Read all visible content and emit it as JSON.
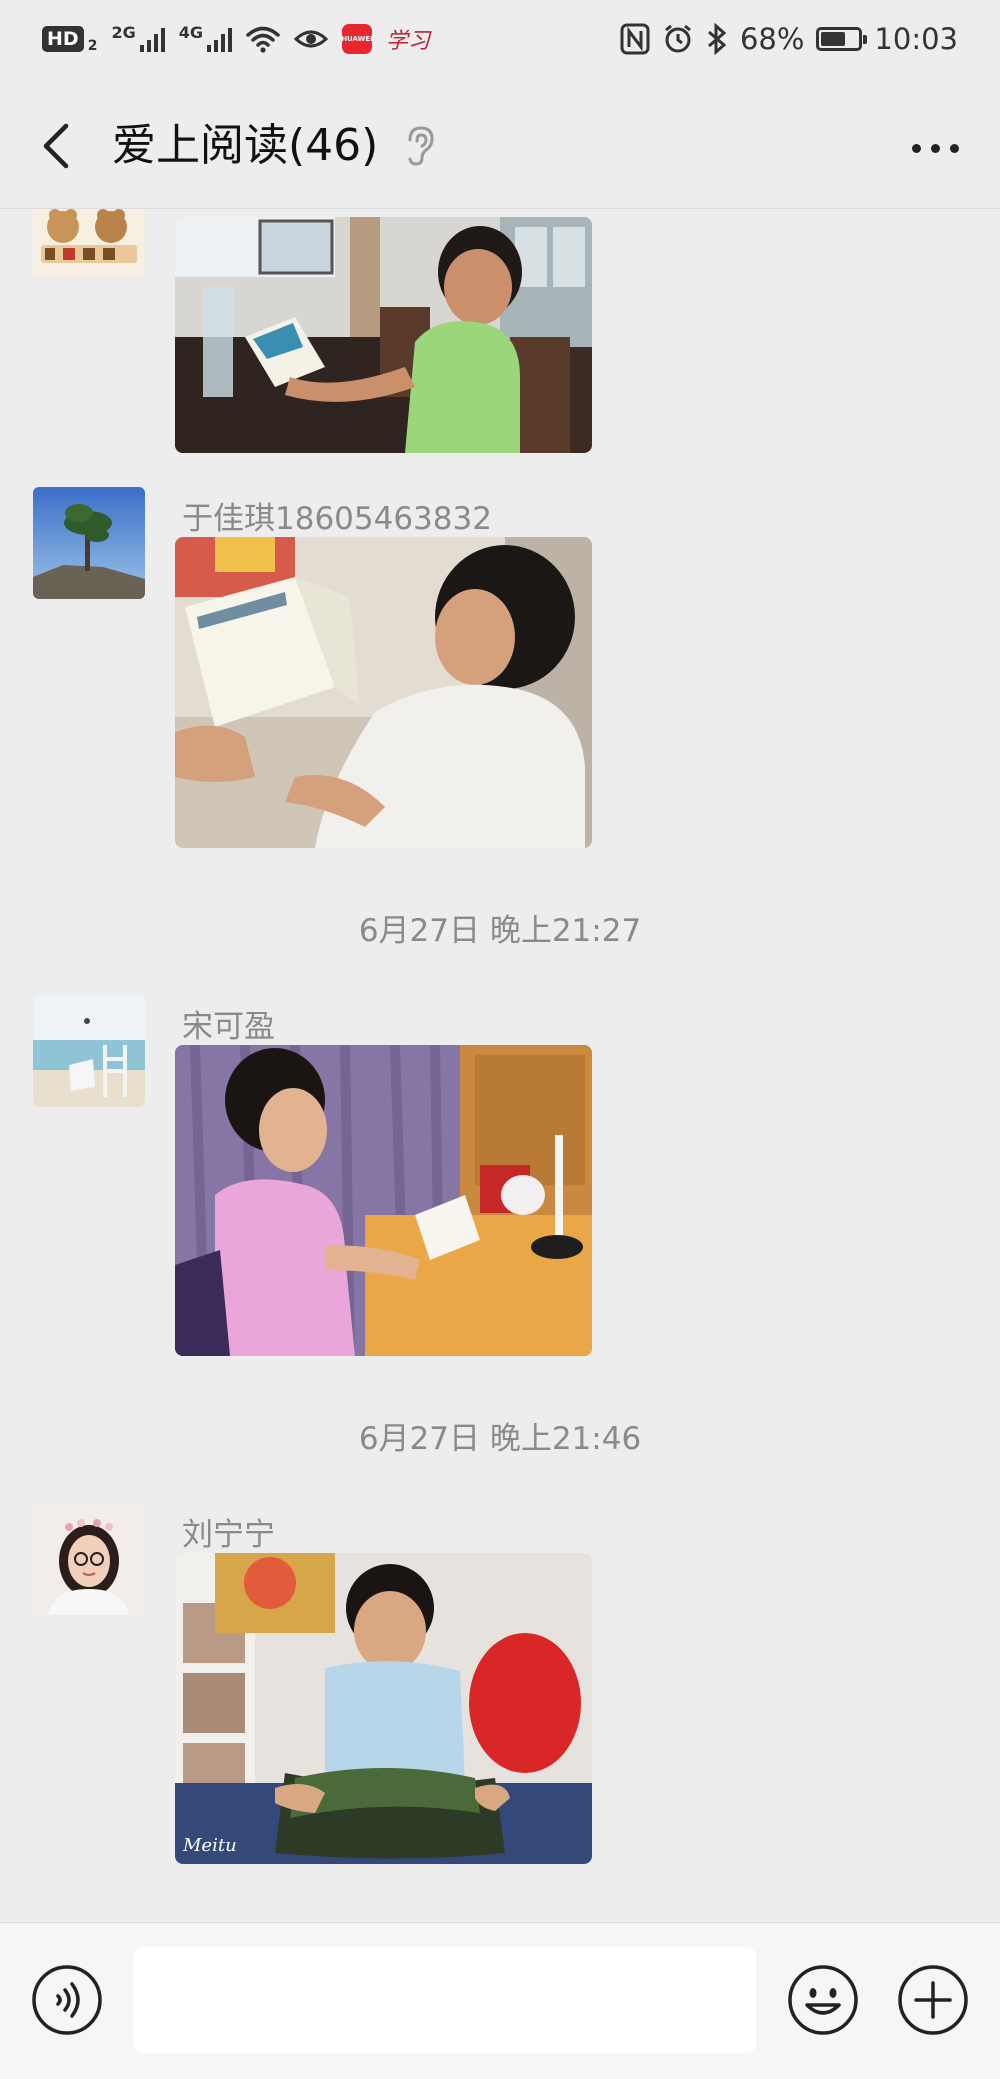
{
  "status_bar": {
    "hd_label": "HD",
    "hd_sub": "2",
    "net1": "2G",
    "net2": "4G",
    "app_badge": "HUAWEI",
    "app2_label": "学习",
    "battery_text": "68%",
    "battery_level": 0.68,
    "time": "10:03"
  },
  "nav": {
    "title": "爱上阅读(46)"
  },
  "messages": [
    {
      "sender": "",
      "avatar": "love-teddy-bears-avatar",
      "photo": "boy-reading-at-table-photo"
    },
    {
      "sender": "于佳琪18605463832",
      "avatar": "tree-on-rock-avatar",
      "photo": "girl-reading-book-photo"
    },
    {
      "sender": "宋可盈",
      "avatar": "beach-chair-avatar",
      "photo": "girl-reading-at-desk-photo"
    },
    {
      "sender": "刘宁宁",
      "avatar": "woman-portrait-avatar",
      "photo": "boy-reading-on-floor-photo",
      "watermark": "Meitu"
    }
  ],
  "timestamps": [
    "6月27日 晚上21:27",
    "6月27日 晚上21:46"
  ],
  "input": {
    "placeholder": ""
  },
  "colors": {
    "background": "#ededed",
    "input_bar": "#f6f6f6",
    "meta_text": "#8a8a8a"
  }
}
